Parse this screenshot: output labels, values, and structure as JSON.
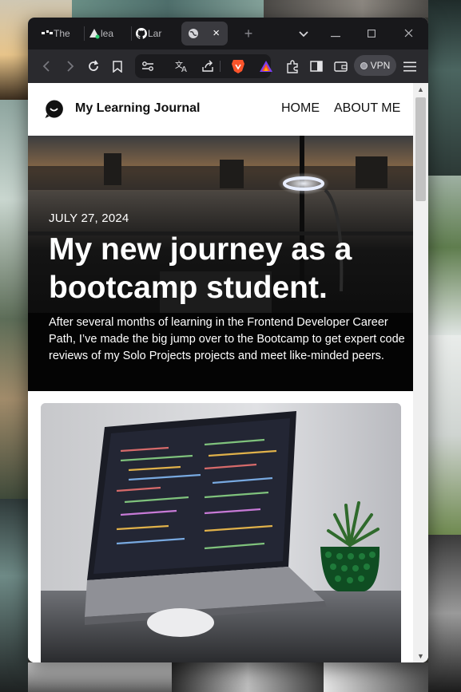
{
  "browser": {
    "tabs": [
      {
        "label": "The",
        "icon": "dots-icon"
      },
      {
        "label": "lea",
        "icon": "triangle-icon"
      },
      {
        "label": "Lar",
        "icon": "github-icon"
      },
      {
        "label": "",
        "icon": "globe-icon",
        "active": true
      }
    ],
    "new_tab_symbol": "+",
    "tab_close_symbol": "×",
    "window": {
      "dropdown": "⌄",
      "minimize": "—",
      "maximize": "☐",
      "close": "✕"
    },
    "toolbar": {
      "back_icon": "arrow-left-icon",
      "forward_icon": "arrow-right-icon",
      "reload_icon": "reload-icon",
      "bookmark_icon": "bookmark-icon",
      "site_settings_icon": "tune-icon",
      "translate_icon": "translate-icon",
      "share_icon": "share-icon",
      "brave_shields_icon": "brave-lion-icon",
      "brave_rewards_icon": "triangle-rewards-icon",
      "extensions_icon": "puzzle-icon",
      "sidebar_icon": "sidebar-icon",
      "wallet_icon": "wallet-icon",
      "vpn_label": "VPN",
      "menu_icon": "hamburger-icon"
    }
  },
  "site": {
    "title": "My Learning Journal",
    "nav": [
      "HOME",
      "ABOUT ME"
    ],
    "logo_icon": "chat-bubble-logo-icon"
  },
  "hero": {
    "date": "JULY 27, 2024",
    "title": "My new journey as a bootcamp student.",
    "description": "After several months of learning in the Frontend Developer Career Path, I’ve made the big jump over to the Bootcamp to get expert code reviews of my Solo Projects projects and meet like-minded peers."
  },
  "post_image": {
    "subject": "laptop-with-code-and-plant"
  },
  "colors": {
    "tab_strip": "#18181b",
    "toolbar": "#2a2a2e",
    "page_bg": "#ffffff",
    "hero_overlay": "#0e0e0e",
    "brave_orange": "#fb542b"
  }
}
